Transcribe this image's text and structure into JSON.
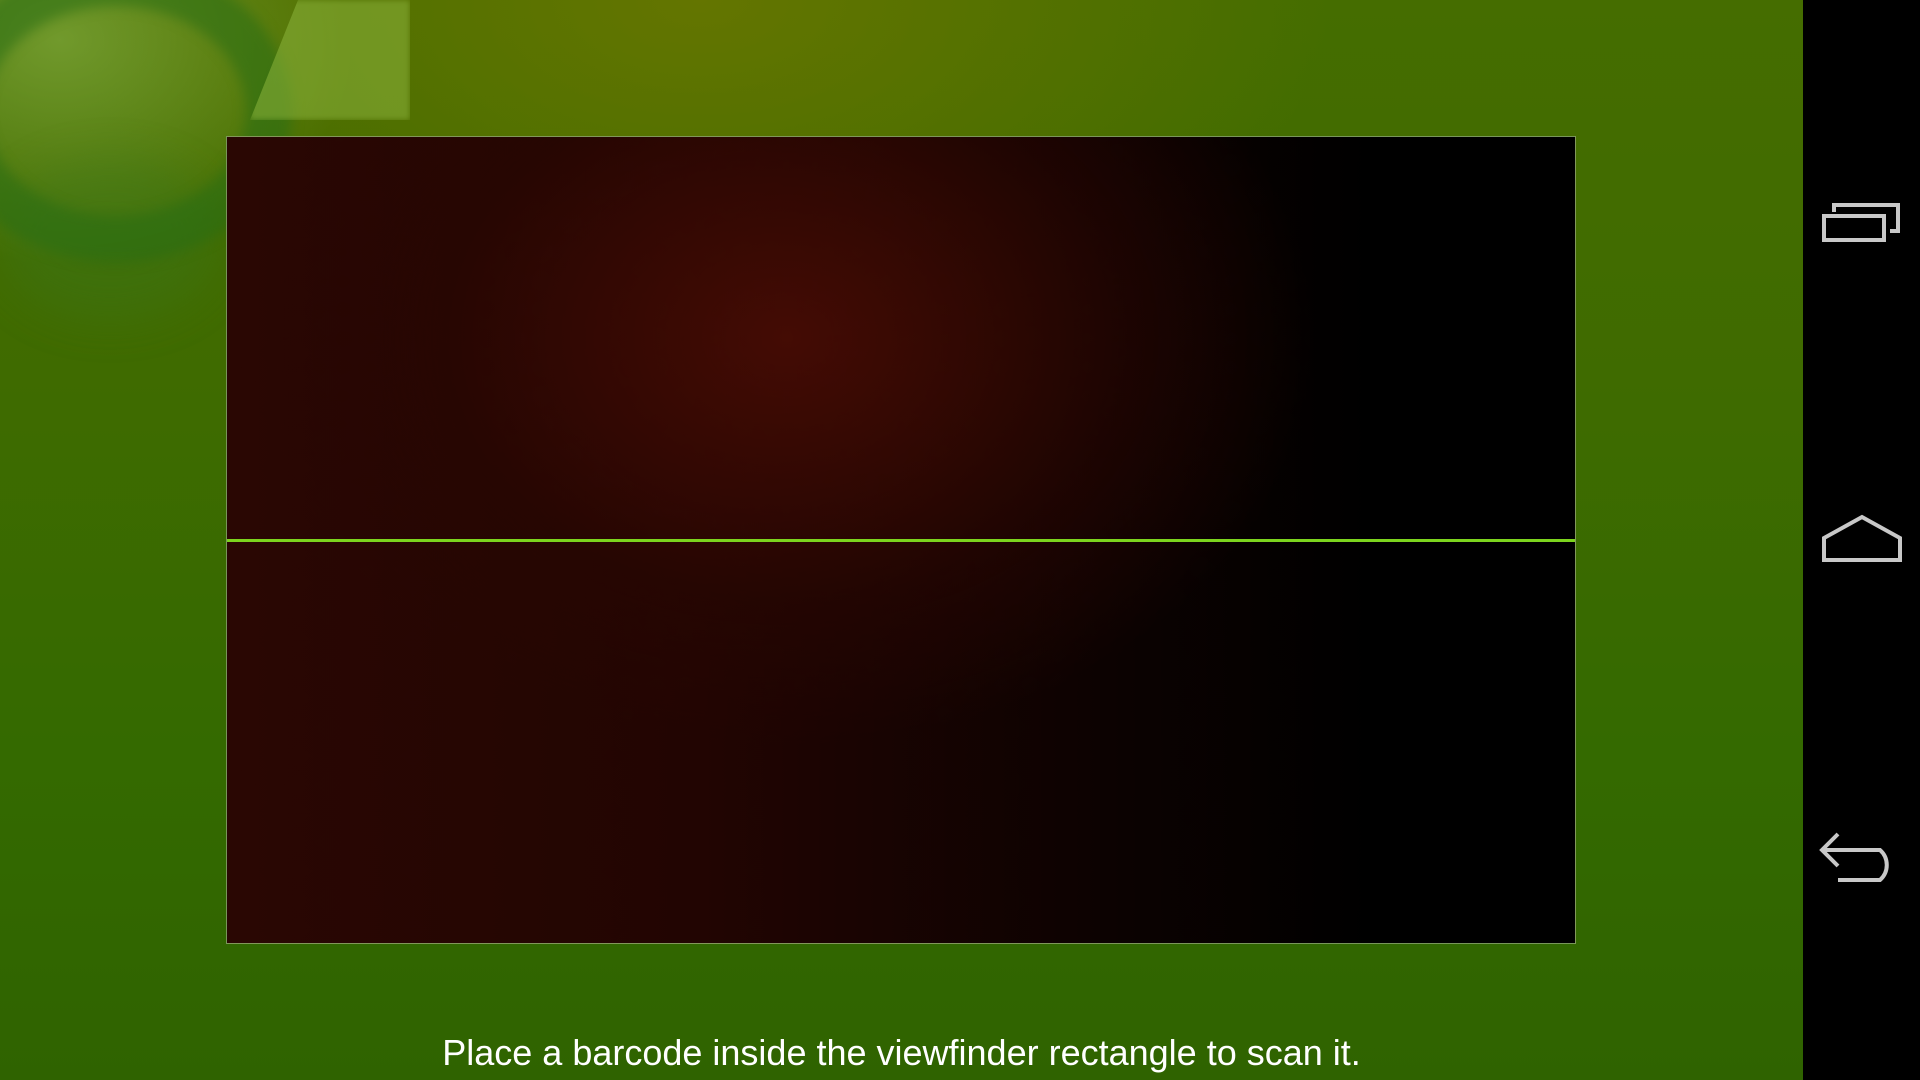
{
  "scanner": {
    "hint": "Place a barcode inside the viewfinder rectangle to scan it.",
    "scan_line_color": "#7cd41e",
    "overlay_color": "#3f6b00"
  },
  "nav_bar": {
    "background": "#000000",
    "icon_color": "#c8c8c8",
    "buttons": [
      {
        "name": "recent-apps",
        "icon": "recent-apps-icon"
      },
      {
        "name": "home",
        "icon": "home-icon"
      },
      {
        "name": "back",
        "icon": "back-icon"
      }
    ]
  }
}
